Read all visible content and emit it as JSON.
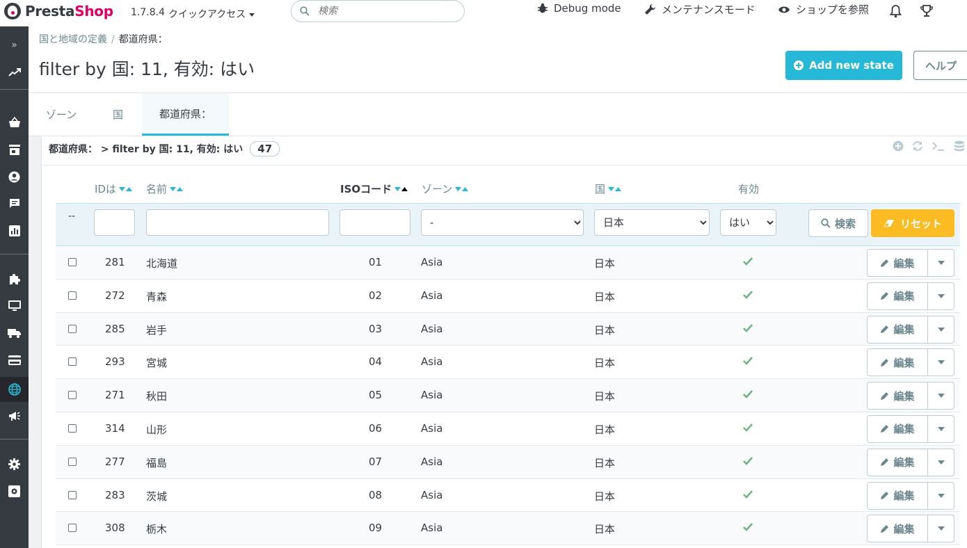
{
  "header": {
    "brand_a": "Presta",
    "brand_b": "Shop",
    "version": "1.7.8.4",
    "quick_access": "クイックアクセス",
    "search_placeholder": "検索",
    "debug": "Debug mode",
    "maintenance": "メンテナンスモード",
    "view_shop": "ショップを参照"
  },
  "breadcrumb": {
    "parent": "国と地域の定義",
    "separator": "/",
    "current": "都道府県："
  },
  "page_title": "filter by 国: 11, 有効: はい",
  "toolbar": {
    "add_label": "Add new state",
    "help_label": "ヘルプ"
  },
  "tabs": [
    {
      "label": "ゾーン"
    },
    {
      "label": "国"
    },
    {
      "label": "都道府県："
    }
  ],
  "panel": {
    "title": "都道府県： > filter by 国: 11, 有効: はい",
    "count": "47"
  },
  "columns": {
    "id": "IDは",
    "name": "名前",
    "iso": "ISOコード",
    "zone": "ゾーン",
    "country": "国",
    "active": "有効"
  },
  "filters": {
    "dash": "--",
    "zone_value": "-",
    "country_value": "日本",
    "active_value": "はい",
    "search_label": "検索",
    "reset_label": "リセット"
  },
  "edit_label": "編集",
  "rows": [
    {
      "id": "281",
      "name": "北海道",
      "iso": "01",
      "zone": "Asia",
      "country": "日本"
    },
    {
      "id": "272",
      "name": "青森",
      "iso": "02",
      "zone": "Asia",
      "country": "日本"
    },
    {
      "id": "285",
      "name": "岩手",
      "iso": "03",
      "zone": "Asia",
      "country": "日本"
    },
    {
      "id": "293",
      "name": "宮城",
      "iso": "04",
      "zone": "Asia",
      "country": "日本"
    },
    {
      "id": "271",
      "name": "秋田",
      "iso": "05",
      "zone": "Asia",
      "country": "日本"
    },
    {
      "id": "314",
      "name": "山形",
      "iso": "06",
      "zone": "Asia",
      "country": "日本"
    },
    {
      "id": "277",
      "name": "福島",
      "iso": "07",
      "zone": "Asia",
      "country": "日本"
    },
    {
      "id": "283",
      "name": "茨城",
      "iso": "08",
      "zone": "Asia",
      "country": "日本"
    },
    {
      "id": "308",
      "name": "栃木",
      "iso": "09",
      "zone": "Asia",
      "country": "日本"
    }
  ],
  "colors": {
    "accent": "#25b9d7",
    "reset": "#fbbb22",
    "check": "#70b580",
    "sidebar": "#363a41"
  }
}
